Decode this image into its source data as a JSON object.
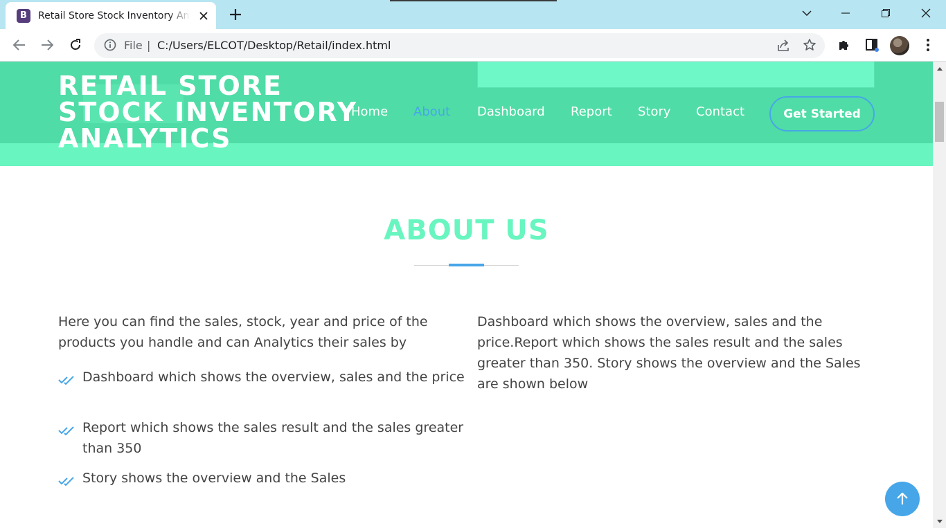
{
  "browser": {
    "tab_title": "Retail Store Stock Inventory Analytics",
    "tab_favicon_letter": "B",
    "address_scheme": "File",
    "address_separator": "|",
    "address_url": "C:/Users/ELCOT/Desktop/Retail/index.html"
  },
  "site": {
    "logo_lines": [
      "RETAIL STORE",
      "STOCK INVENTORY",
      "ANALYTICS"
    ],
    "nav": [
      "Home",
      "About",
      "Dashboard",
      "Report",
      "Story",
      "Contact"
    ],
    "active_nav": "About",
    "cta": "Get Started"
  },
  "about": {
    "title": "ABOUT US",
    "intro": "Here you can find the sales, stock, year and price of the products you handle and can Analytics their sales by",
    "list": [
      "Dashboard which shows the overview, sales and the price",
      "Report which shows the sales result and the sales greater than 350",
      "Story shows the overview and the Sales"
    ],
    "right_text": "Dashboard which shows the overview, sales and the price.Report which shows the sales result and the sales greater than 350. Story shows the overview and the Sales are shown below"
  },
  "colors": {
    "header": "#4fdca6",
    "mint": "#68f5c0",
    "accent": "#47a6e8",
    "text": "#444444"
  },
  "icons": {
    "back": "arrow-left-icon",
    "forward": "arrow-right-icon",
    "reload": "reload-icon",
    "info": "info-icon",
    "share": "share-icon",
    "bookmark": "star-icon",
    "extensions": "puzzle-icon",
    "sidepanel": "side-panel-icon",
    "menu": "kebab-menu-icon",
    "list_check": "double-check-icon",
    "back_to_top": "arrow-up-icon"
  }
}
